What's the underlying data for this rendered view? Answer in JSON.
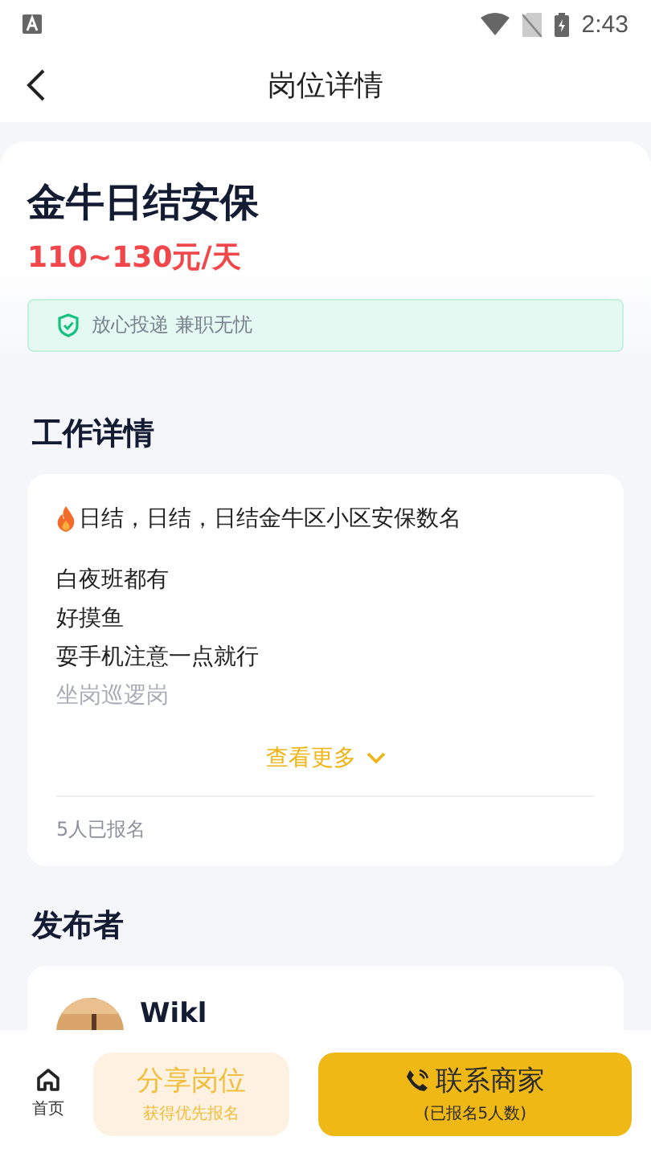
{
  "status_bar": {
    "time": "2:43"
  },
  "header": {
    "title": "岗位详情"
  },
  "job": {
    "title": "金牛日结安保",
    "salary": "110~130元/天",
    "guarantee": "放心投递 兼职无忧"
  },
  "details": {
    "heading": "工作详情",
    "paragraphs": [
      {
        "lines": [
          "日结，日结，日结金牛区小区安保数名"
        ]
      },
      {
        "lines": [
          "白夜班都有",
          "好摸鱼",
          "耍手机注意一点就行",
          "坐岗巡逻岗"
        ]
      }
    ],
    "more": "查看更多",
    "signups": "5人已报名"
  },
  "publisher": {
    "heading": "发布者",
    "name": "Wikl"
  },
  "bottom_bar": {
    "home": "首页",
    "share": {
      "label": "分享岗位",
      "sub": "获得优先报名"
    },
    "contact": {
      "label": "联系商家",
      "sub": "(已报名5人数)"
    }
  }
}
